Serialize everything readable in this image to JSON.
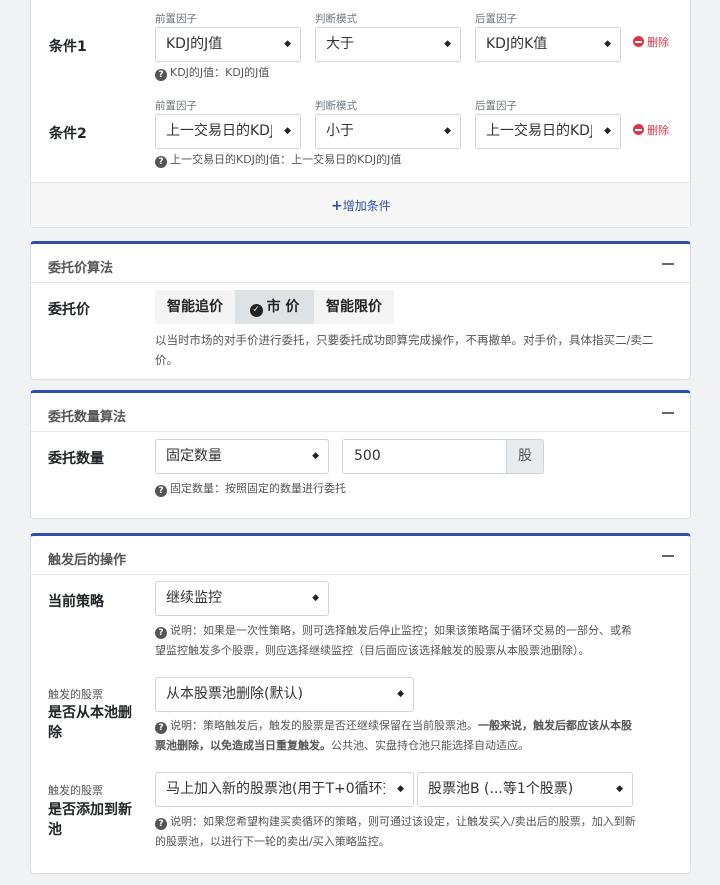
{
  "conditions": {
    "pre_factor_label": "前置因子",
    "mode_label": "判断模式",
    "post_factor_label": "后置因子",
    "delete_label": "删除",
    "add_label": "增加条件",
    "items": [
      {
        "name": "条件1",
        "pre": "KDJ的J值",
        "mode": "大于",
        "post": "KDJ的K值",
        "help": "KDJ的J值：KDJ的J值"
      },
      {
        "name": "条件2",
        "pre": "上一交易日的KDJ",
        "mode": "小于",
        "post": "上一交易日的KDJ",
        "help": "上一交易日的KDJ的J值：上一交易日的KDJ的J值"
      }
    ]
  },
  "price_algo": {
    "title": "委托价算法",
    "label": "委托价",
    "options": [
      "智能追价",
      "市  价",
      "智能限价"
    ],
    "active_index": 1,
    "desc_line1": "以当时市场的对手价进行委托，只要委托成功即算完成操作，不再撤单。对手价，具体指买二/卖二",
    "desc_line2": "价。"
  },
  "qty_algo": {
    "title": "委托数量算法",
    "label": "委托数量",
    "mode": "固定数量",
    "value": "500",
    "unit": "股",
    "help": "固定数量：按照固定的数量进行委托"
  },
  "after_trigger": {
    "title": "触发后的操作",
    "strategy_label": "当前策略",
    "strategy_value": "继续监控",
    "strategy_help_1": "说明：如果是一次性策略，则可选择触发后停止监控；如果该策略属于循环交易的一部分、或希",
    "strategy_help_2": "望监控触发多个股票，则应选择继续监控（目后面应该选择触发的股票从本股票池删除）。",
    "remove_small": "触发的股票",
    "remove_label_1": "是否从本池删",
    "remove_label_2": "除",
    "remove_value": "从本股票池删除(默认)",
    "remove_help_1a": "说明：策略触发后，触发的股票是否还继续保留在当前股票池。",
    "remove_help_1b": "一般来说，触发后都应该从本股",
    "remove_help_2a": "票池删除，以免造成当日重复触发。",
    "remove_help_2b": "公共池、实盘持仓池只能选择自动适应。",
    "add_small": "触发的股票",
    "add_label_1": "是否添加到新",
    "add_label_2": "池",
    "add_value": "马上加入新的股票池(用于T+0循环交",
    "pool_value": "股票池B (...等1个股票)",
    "add_help_1": "说明：如果您希望构建买卖循环的策略，则可通过该设定，让触发买入/卖出后的股票，加入到新",
    "add_help_2": "的股票池，以进行下一轮的卖出/买入策略监控。"
  },
  "icons": {
    "select_arrow": "updown-arrow-icon",
    "help": "question-circle-icon",
    "delete": "minus-circle-icon",
    "add": "plus-icon",
    "check": "check-circle-icon",
    "collapse": "minus-icon"
  },
  "colors": {
    "accent": "#2f4fa8",
    "danger": "#dc3545"
  }
}
